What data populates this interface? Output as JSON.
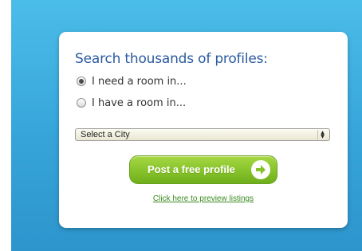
{
  "search_panel": {
    "heading": "Search thousands of profiles:",
    "options": [
      {
        "label": "I need a room in...",
        "selected": true
      },
      {
        "label": "I have a room in...",
        "selected": false
      }
    ],
    "city_select": {
      "selected_value": "Select a City"
    },
    "cta_label": "Post a free profile",
    "cta_icon": "arrow-right-circle-icon",
    "preview_link": "Click here to preview listings"
  },
  "colors": {
    "background_blue": "#36a4d9",
    "heading_blue": "#2a5aa0",
    "cta_green": "#86c22a",
    "link_green": "#3a8a1e"
  }
}
